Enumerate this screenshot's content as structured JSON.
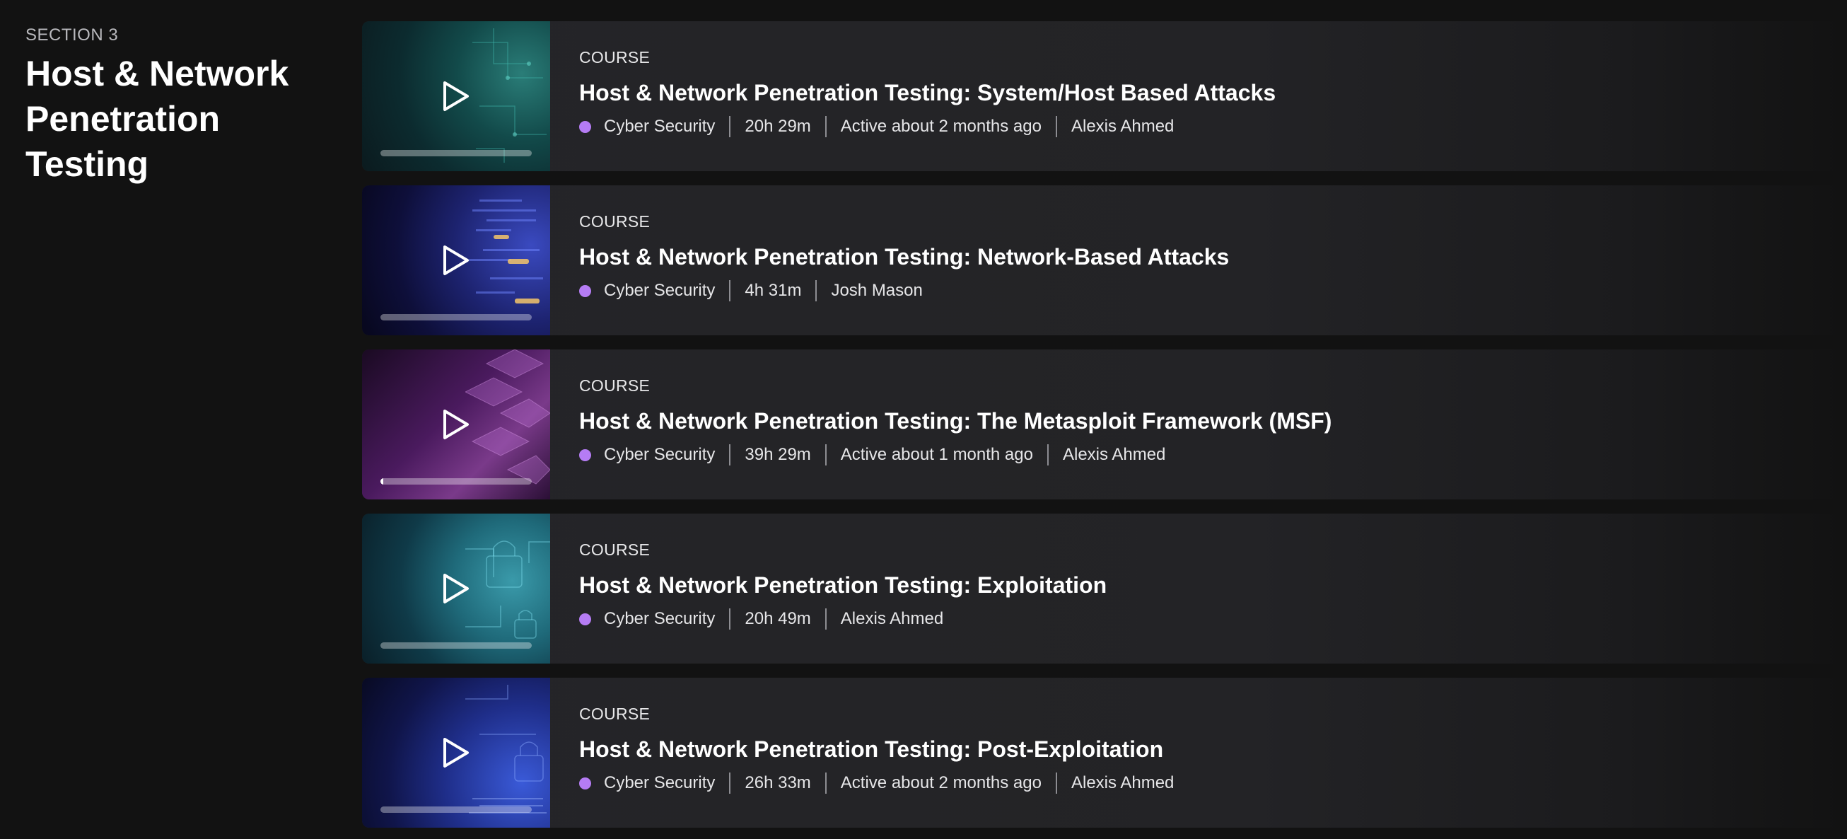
{
  "section": {
    "label": "SECTION 3",
    "title": "Host & Network Penetration Testing"
  },
  "accent_colors": {
    "category_dot": "#b57cf4",
    "background": "#121212",
    "card": "#252528"
  },
  "courses": [
    {
      "type": "COURSE",
      "title": "Host & Network Penetration Testing: System/Host Based Attacks",
      "category": "Cyber Security",
      "duration": "20h 29m",
      "activity": "Active about 2 months ago",
      "author": "Alexis Ahmed",
      "progress": 0
    },
    {
      "type": "COURSE",
      "title": "Host & Network Penetration Testing: Network-Based Attacks",
      "category": "Cyber Security",
      "duration": "4h 31m",
      "activity": null,
      "author": "Josh Mason",
      "progress": 0
    },
    {
      "type": "COURSE",
      "title": "Host & Network Penetration Testing: The Metasploit Framework (MSF)",
      "category": "Cyber Security",
      "duration": "39h 29m",
      "activity": "Active about 1 month ago",
      "author": "Alexis Ahmed",
      "progress": 0.02
    },
    {
      "type": "COURSE",
      "title": "Host & Network Penetration Testing: Exploitation",
      "category": "Cyber Security",
      "duration": "20h 49m",
      "activity": null,
      "author": "Alexis Ahmed",
      "progress": 0
    },
    {
      "type": "COURSE",
      "title": "Host & Network Penetration Testing: Post-Exploitation",
      "category": "Cyber Security",
      "duration": "26h 33m",
      "activity": "Active about 2 months ago",
      "author": "Alexis Ahmed",
      "progress": 0
    }
  ]
}
